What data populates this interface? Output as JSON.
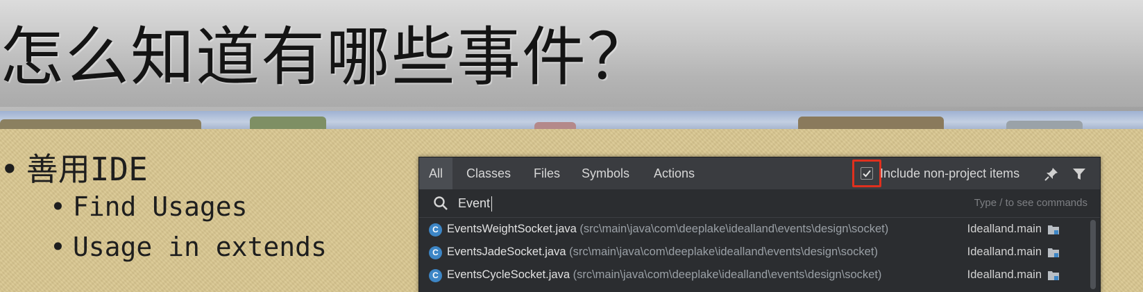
{
  "slide": {
    "title": "怎么知道有哪些事件？",
    "bullet_main": "善用IDE",
    "bullet_dot": "•",
    "sub_bullets": [
      "Find Usages",
      "Usage in extends"
    ]
  },
  "ide": {
    "tabs": [
      "All",
      "Classes",
      "Files",
      "Symbols",
      "Actions"
    ],
    "include_label": "Include non-project items",
    "include_checked": true,
    "search_value": "Event",
    "hint": "Type / to see commands",
    "results": [
      {
        "icon": "C",
        "name": "EventsWeightSocket.java",
        "path": "(src\\main\\java\\com\\deeplake\\idealland\\events\\design\\socket)",
        "module": "Idealland.main"
      },
      {
        "icon": "C",
        "name": "EventsJadeSocket.java",
        "path": "(src\\main\\java\\com\\deeplake\\idealland\\events\\design\\socket)",
        "module": "Idealland.main"
      },
      {
        "icon": "C",
        "name": "EventsCycleSocket.java",
        "path": "(src\\main\\java\\com\\deeplake\\idealland\\events\\design\\socket)",
        "module": "Idealland.main"
      }
    ],
    "colors": {
      "panel": "#2b2d30",
      "tab_bar": "#3a3c40",
      "highlight_box": "#e0301e",
      "class_icon": "#3d86c6"
    }
  }
}
